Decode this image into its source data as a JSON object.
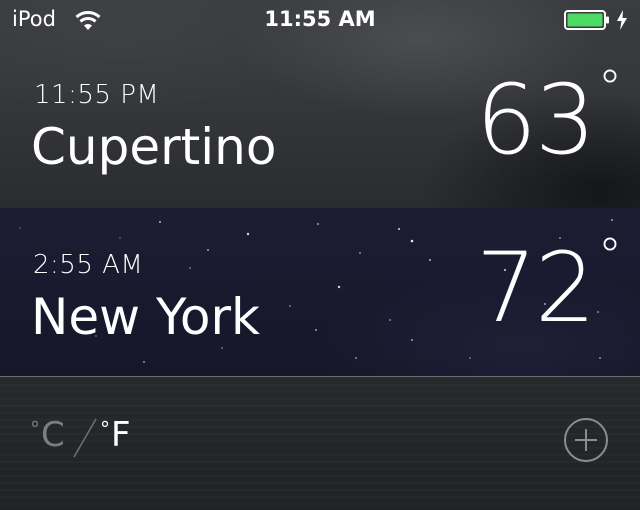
{
  "status_bar": {
    "carrier": "iPod",
    "time": "11:55 AM",
    "battery_color": "#4cd964"
  },
  "cities": [
    {
      "local_time": "11:55 PM",
      "name": "Cupertino",
      "temp": "63",
      "degree": "°"
    },
    {
      "local_time": "2:55 AM",
      "name": "New York",
      "temp": "72",
      "degree": "°"
    }
  ],
  "footer": {
    "celsius_label": "C",
    "fahrenheit_label": "F",
    "degree_symbol": "°",
    "active_unit": "F",
    "inactive_color": "#7b7f80",
    "active_color": "#ffffff"
  },
  "icons": [
    "wifi-icon",
    "battery-icon",
    "charging-bolt-icon",
    "add-city-icon"
  ]
}
